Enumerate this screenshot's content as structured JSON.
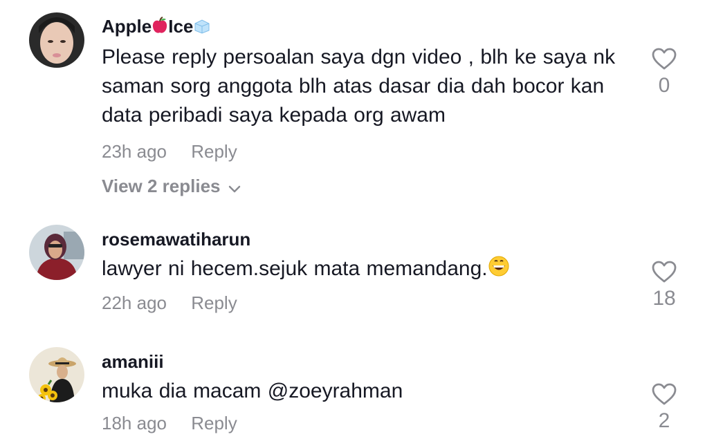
{
  "comments": [
    {
      "username_prefix": "Apple",
      "username_mid": "Ice",
      "username_icons": [
        "apple-emoji-icon",
        "ice-cube-emoji-icon"
      ],
      "text": "Please reply persoalan saya dgn video , blh ke saya nk saman sorg anggota blh atas dasar dia dah bocor kan data peribadi saya kepada org awam",
      "time": "23h ago",
      "reply_label": "Reply",
      "likes": "0",
      "view_replies": "View 2 replies"
    },
    {
      "username": "rosemawatiharun",
      "text": "lawyer ni hecem.sejuk mata memandang.",
      "text_emoji": "grinning-face-emoji-icon",
      "time": "22h ago",
      "reply_label": "Reply",
      "likes": "18"
    },
    {
      "username": "amaniii",
      "text": "muka dia macam @zoeyrahman",
      "time": "18h ago",
      "reply_label": "Reply",
      "likes": "2"
    }
  ],
  "colors": {
    "text_primary": "#161823",
    "text_secondary": "#8a8b91",
    "background": "#ffffff"
  }
}
